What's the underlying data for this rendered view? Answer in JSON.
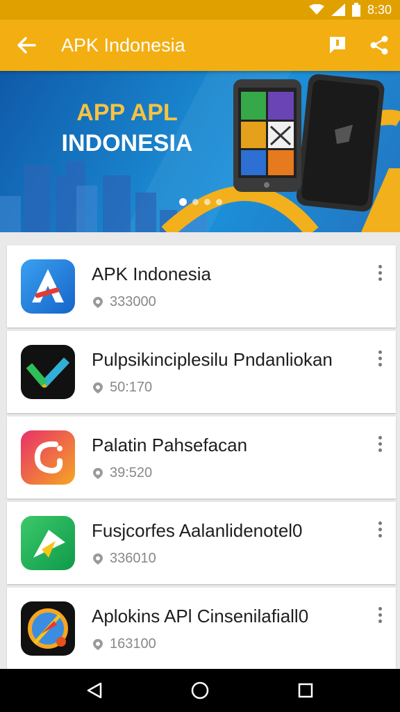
{
  "status_bar": {
    "time": "8:30",
    "icons": [
      "wifi-icon",
      "signal-icon",
      "battery-icon"
    ]
  },
  "app_bar": {
    "title": "APK Indonesia",
    "back_icon": "arrow-left-icon",
    "actions": [
      "bookmark-icon",
      "share-icon"
    ]
  },
  "banner": {
    "line1": "APP APL",
    "line2": "INDONESIA",
    "pages": 4,
    "active_page": 1
  },
  "apps": [
    {
      "name": "APK Indonesia",
      "count": "333000",
      "icon": "apk-a-logo-icon"
    },
    {
      "name": "Pulpsikinciplesilu Pndanliokan",
      "count": "50:170",
      "icon": "checkmark-logo-icon"
    },
    {
      "name": "Palatin Pahsefacan",
      "count": "39:520",
      "icon": "swirl-logo-icon"
    },
    {
      "name": "Fusjcorfes Aalanlidenotel0",
      "count": "336010",
      "icon": "arrow-logo-icon"
    },
    {
      "name": "Aplokins APl Cinsenilafiall0",
      "count": "163100",
      "icon": "compass-logo-icon"
    }
  ],
  "colors": {
    "status_bar": "#e0a000",
    "app_bar": "#f3ae12",
    "banner_blue": "#1a86cf",
    "nav_bar": "#000000"
  },
  "nav_bar": {
    "buttons": [
      "back-triangle-icon",
      "home-circle-icon",
      "recents-square-icon"
    ]
  }
}
